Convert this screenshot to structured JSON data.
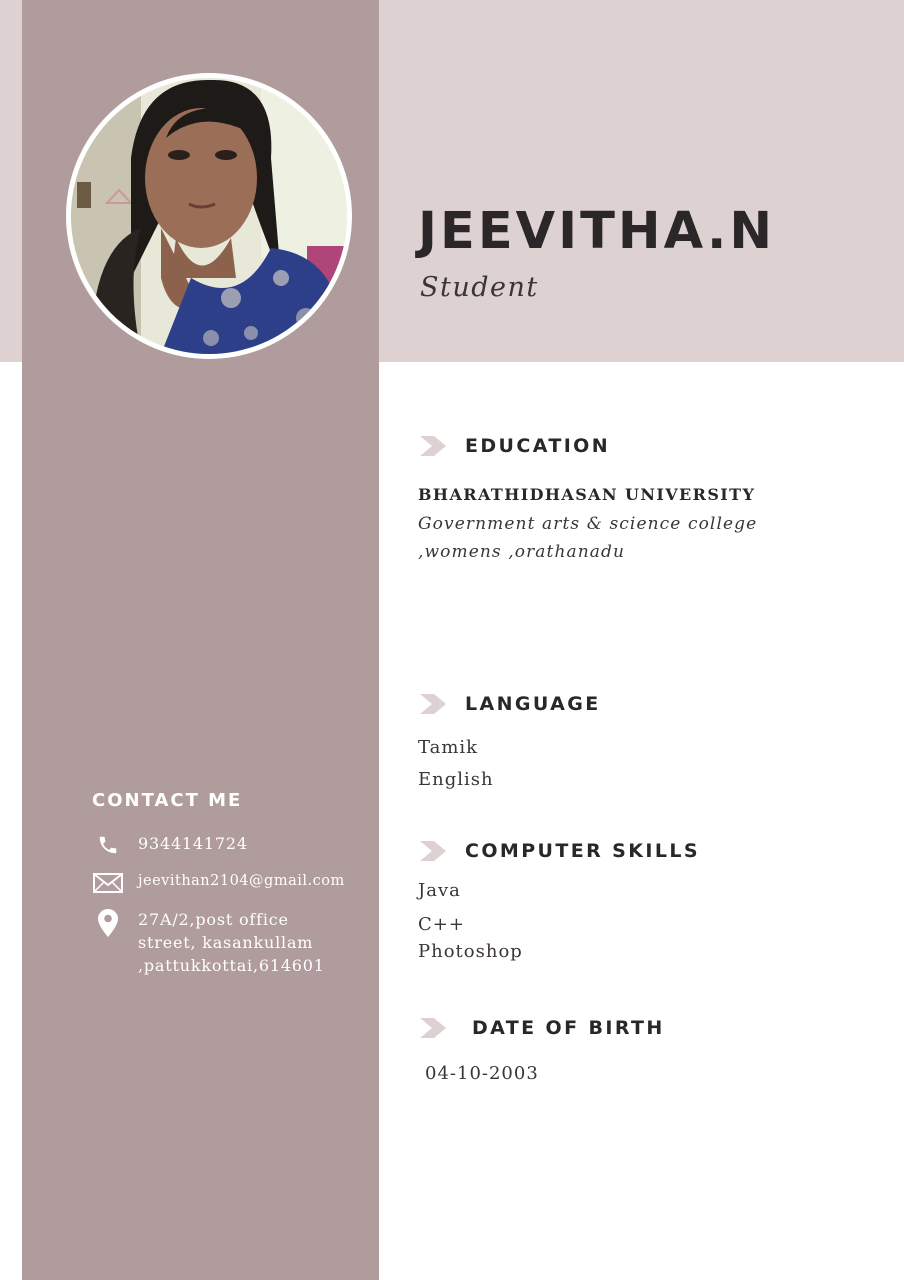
{
  "profile": {
    "name": "JEEVITHA.N",
    "role": "Student"
  },
  "education": {
    "title": "EDUCATION",
    "institution": "BHARATHIDHASAN UNIVERSITY",
    "college_line1": "Government arts & science college",
    "college_line2": ",womens ,orathanadu"
  },
  "language": {
    "title": "LANGUAGE",
    "items": [
      "Tamik",
      "English"
    ]
  },
  "computer_skills": {
    "title": "COMPUTER SKILLS",
    "items": [
      "Java",
      "C++",
      "Photoshop"
    ]
  },
  "date_of_birth": {
    "title": "DATE OF BIRTH",
    "value": "04-10-2003"
  },
  "contact": {
    "title": "CONTACT ME",
    "phone": "9344141724",
    "email": "jeevithan2104@gmail.com",
    "address_line1": "27A/2,post office",
    "address_line2": "street, kasankullam",
    "address_line3": ",pattukkottai,614601",
    "icons": [
      "phone-icon",
      "mail-icon",
      "location-pin-icon"
    ]
  },
  "colors": {
    "top_band": "#ddd1d1",
    "side_column": "#b09c9c",
    "heading_text": "#2b2628",
    "chevron": "#ddd1d1"
  }
}
